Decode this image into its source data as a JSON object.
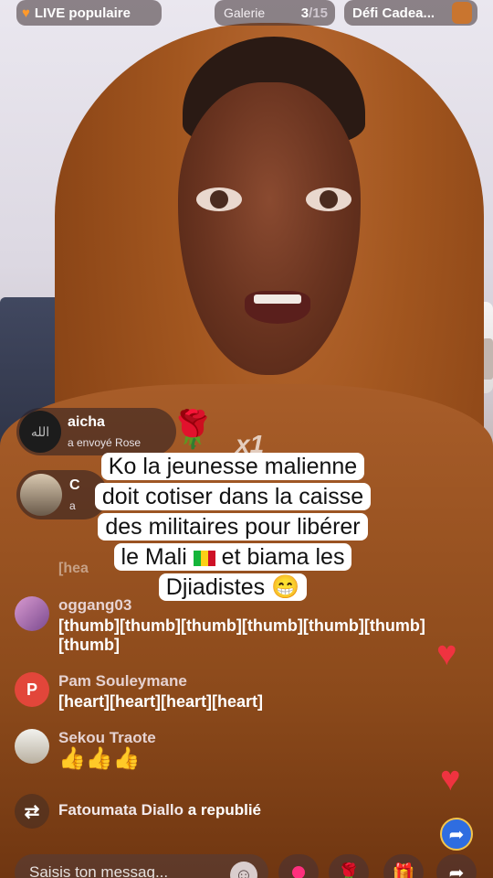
{
  "top_bar": {
    "live_label": "LIVE populaire",
    "gallery_label": "Galerie",
    "gallery_current": "3",
    "gallery_total": "/15",
    "gift_challenge_label": "Défi Cadea..."
  },
  "gift_notifications": [
    {
      "user": "aicha",
      "action": "a envoyé  Rose",
      "multiplier": "x1",
      "avatar_text": "الله"
    },
    {
      "user": "C",
      "action": "a"
    }
  ],
  "caption": {
    "line1": "Ko la jeunesse malienne",
    "line2": "doit cotiser dans la caisse",
    "line3": "des militaires pour libérer",
    "line4_before_flag": "le Mali ",
    "line4_after_flag": " et biama les",
    "line5": "Djiadistes 😁"
  },
  "faded_comment": "[hea",
  "comments": [
    {
      "user": "oggang03",
      "text": "[thumb][thumb][thumb][thumb][thumb][thumb][thumb]",
      "avatar_letter": ""
    },
    {
      "user": "Pam Souleymane",
      "text": "[heart][heart][heart][heart]",
      "avatar_letter": "P"
    },
    {
      "user": "Sekou Traote",
      "text": "👍👍👍",
      "avatar_letter": ""
    }
  ],
  "repost": {
    "user": "Fatoumata Diallo",
    "action": " a republié",
    "icon": "repost-icon"
  },
  "input": {
    "placeholder": "Saisis ton messag..."
  },
  "colors": {
    "heart": "#ef3340",
    "live_heart": "#ff9a2a",
    "share": "#2f6de0"
  }
}
